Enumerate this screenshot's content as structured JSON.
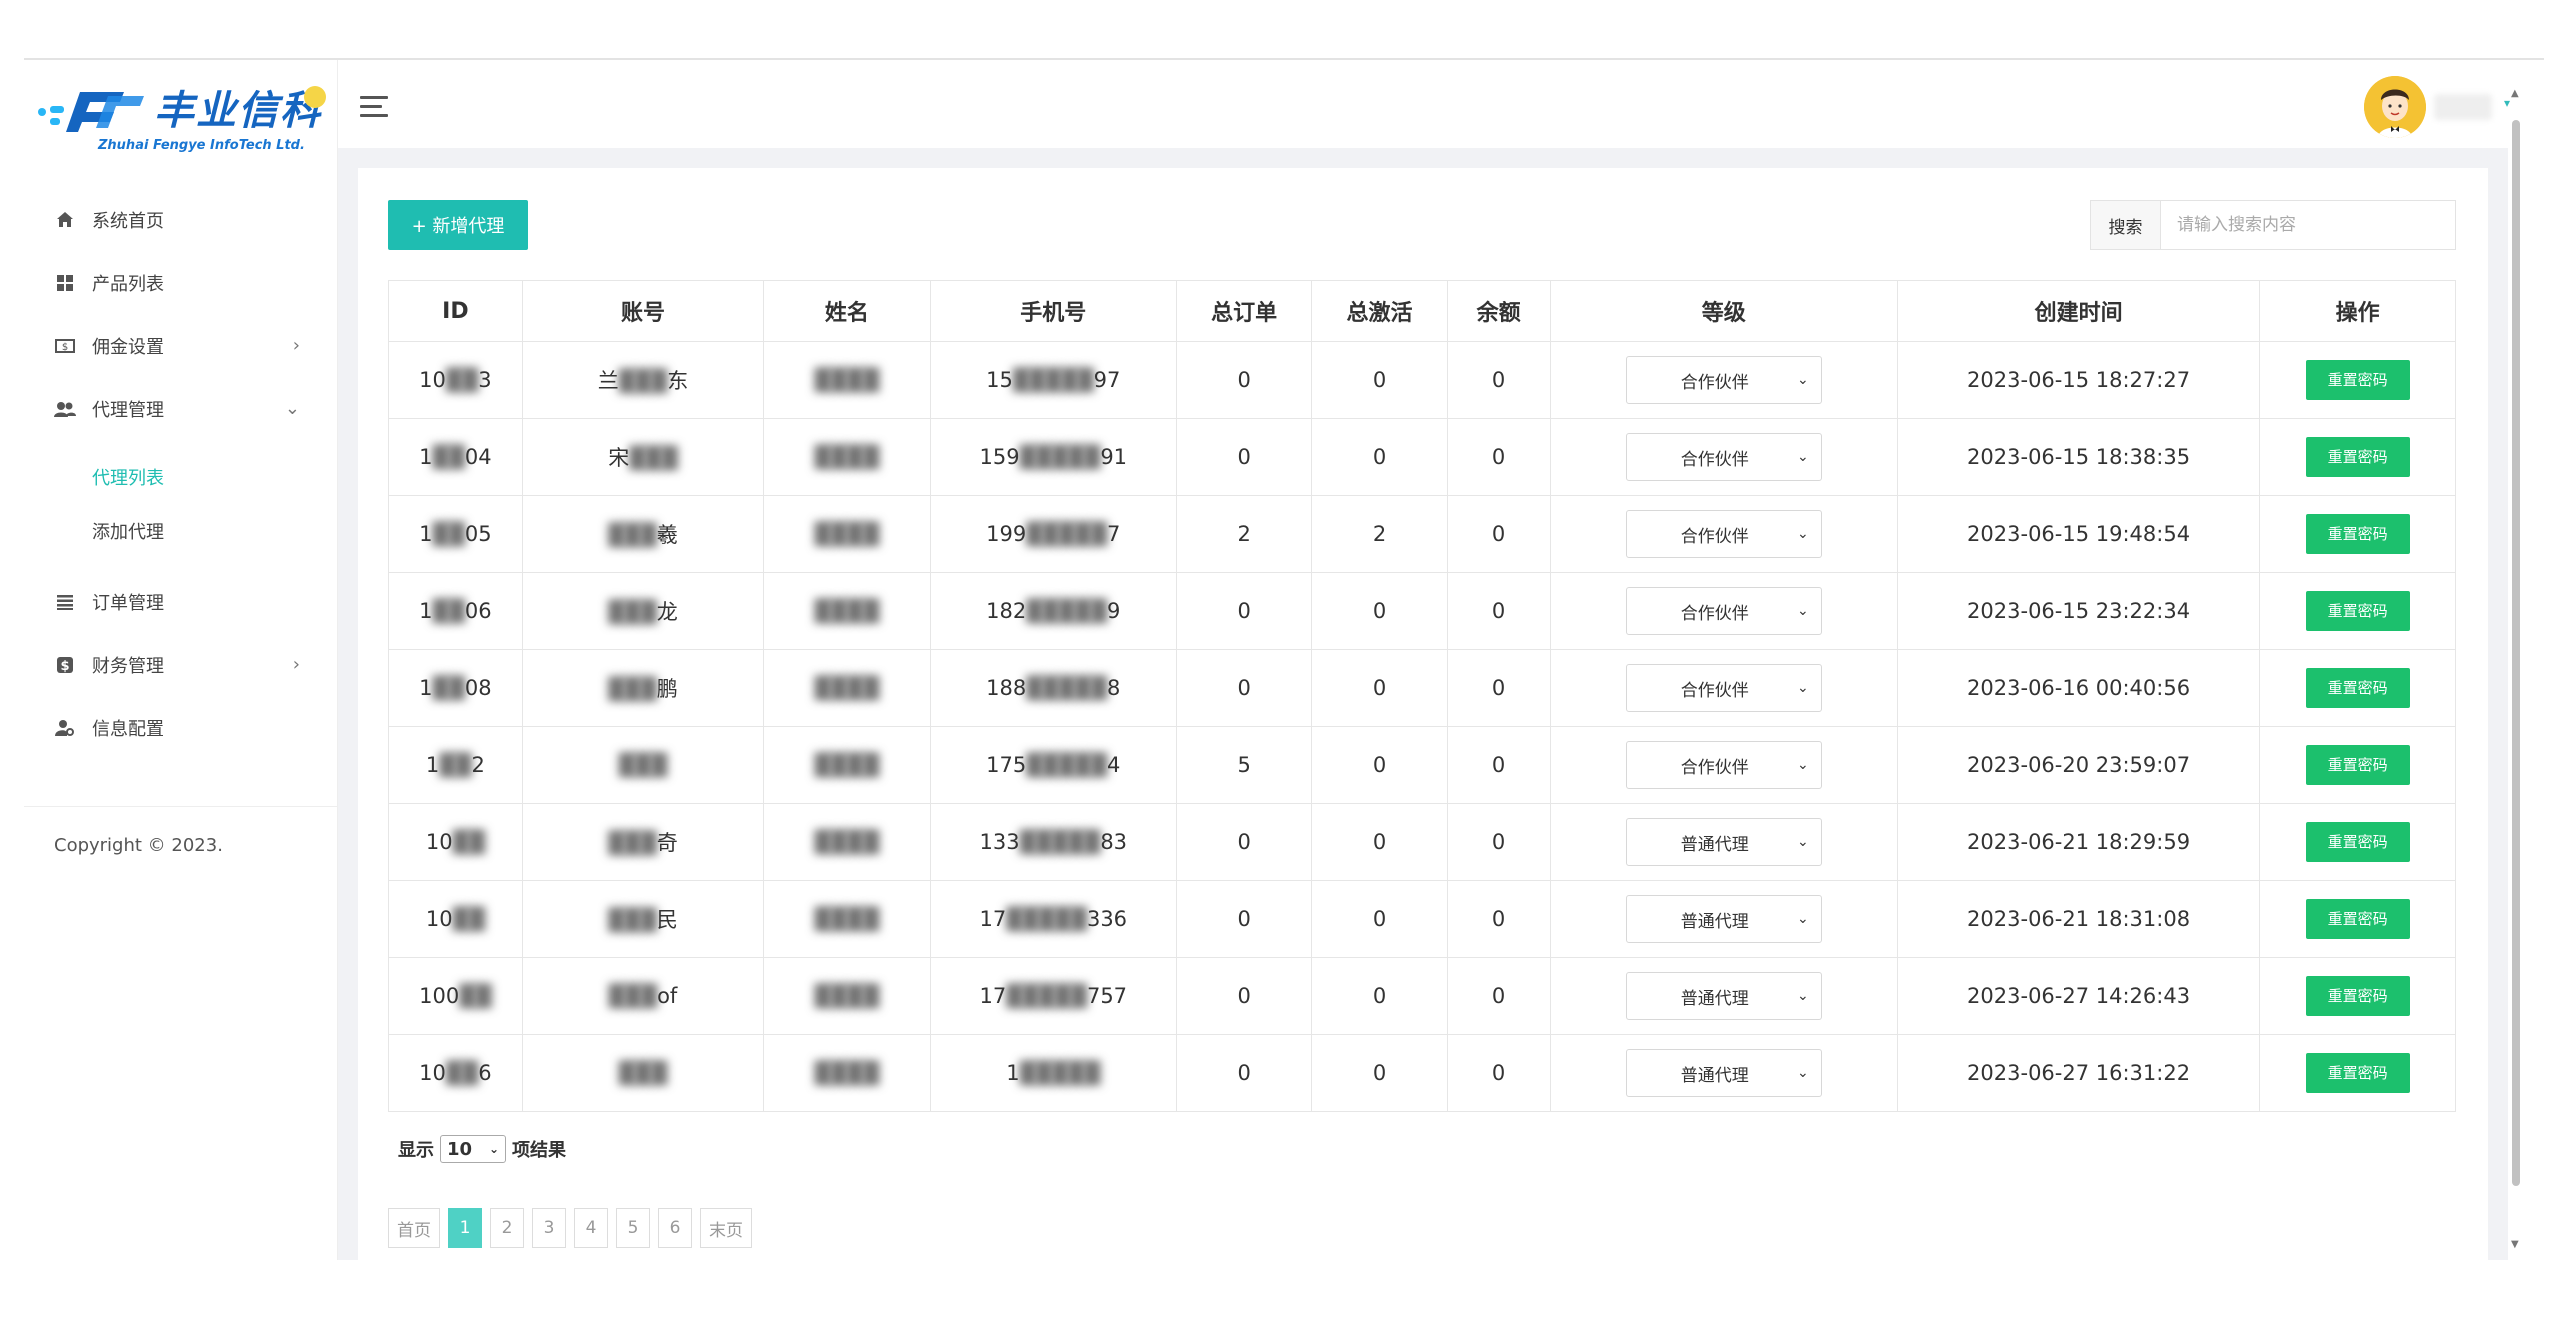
{
  "brand": {
    "name_cn": "丰业信科",
    "name_en": "Zhuhai Fengye InfoTech Ltd.",
    "color": "#1565c0"
  },
  "sidebar": {
    "items": [
      {
        "label": "系统首页",
        "icon": "home-icon"
      },
      {
        "label": "产品列表",
        "icon": "grid-icon"
      },
      {
        "label": "佣金设置",
        "icon": "money-icon",
        "caret": "›"
      },
      {
        "label": "代理管理",
        "icon": "users-icon",
        "caret": "⌄"
      },
      {
        "label": "订单管理",
        "icon": "list-icon"
      },
      {
        "label": "财务管理",
        "icon": "dollar-icon",
        "caret": "›"
      },
      {
        "label": "信息配置",
        "icon": "user-settings-icon"
      }
    ],
    "subitems": [
      {
        "label": "代理列表",
        "active": true
      },
      {
        "label": "添加代理",
        "active": false
      }
    ],
    "copyright": "Copyright © 2023."
  },
  "toolbar": {
    "add_label": "+ 新增代理",
    "search_label": "搜索",
    "search_placeholder": "请输入搜索内容"
  },
  "table": {
    "headers": [
      "ID",
      "账号",
      "姓名",
      "手机号",
      "总订单",
      "总激活",
      "余额",
      "等级",
      "创建时间",
      "操作"
    ],
    "action_label": "重置密码",
    "rows": [
      {
        "id_a": "10",
        "id_b": "3",
        "acc_a": "兰",
        "acc_b": "东",
        "phone_a": "15",
        "phone_b": "97",
        "orders": "0",
        "activations": "0",
        "balance": "0",
        "level": "合作伙伴",
        "created": "2023-06-15 18:27:27"
      },
      {
        "id_a": "1",
        "id_b": "04",
        "acc_a": "宋",
        "acc_b": "",
        "phone_a": "159",
        "phone_b": "91",
        "orders": "0",
        "activations": "0",
        "balance": "0",
        "level": "合作伙伴",
        "created": "2023-06-15 18:38:35"
      },
      {
        "id_a": "1",
        "id_b": "05",
        "acc_a": "",
        "acc_b": "羲",
        "phone_a": "199",
        "phone_b": "7",
        "orders": "2",
        "activations": "2",
        "balance": "0",
        "level": "合作伙伴",
        "created": "2023-06-15 19:48:54"
      },
      {
        "id_a": "1",
        "id_b": "06",
        "acc_a": "",
        "acc_b": "龙",
        "phone_a": "182",
        "phone_b": "9",
        "orders": "0",
        "activations": "0",
        "balance": "0",
        "level": "合作伙伴",
        "created": "2023-06-15 23:22:34"
      },
      {
        "id_a": "1",
        "id_b": "08",
        "acc_a": "",
        "acc_b": "鹏",
        "phone_a": "188",
        "phone_b": "8",
        "orders": "0",
        "activations": "0",
        "balance": "0",
        "level": "合作伙伴",
        "created": "2023-06-16 00:40:56"
      },
      {
        "id_a": "1",
        "id_b": "2",
        "acc_a": "",
        "acc_b": "",
        "phone_a": "175",
        "phone_b": "4",
        "orders": "5",
        "activations": "0",
        "balance": "0",
        "level": "合作伙伴",
        "created": "2023-06-20 23:59:07"
      },
      {
        "id_a": "10",
        "id_b": "",
        "acc_a": "",
        "acc_b": "奇",
        "phone_a": "133",
        "phone_b": "83",
        "orders": "0",
        "activations": "0",
        "balance": "0",
        "level": "普通代理",
        "created": "2023-06-21 18:29:59"
      },
      {
        "id_a": "10",
        "id_b": "",
        "acc_a": "",
        "acc_b": "民",
        "phone_a": "17",
        "phone_b": "336",
        "orders": "0",
        "activations": "0",
        "balance": "0",
        "level": "普通代理",
        "created": "2023-06-21 18:31:08"
      },
      {
        "id_a": "100",
        "id_b": "",
        "acc_a": "",
        "acc_b": "of",
        "phone_a": "17",
        "phone_b": "757",
        "orders": "0",
        "activations": "0",
        "balance": "0",
        "level": "普通代理",
        "created": "2023-06-27 14:26:43"
      },
      {
        "id_a": "10",
        "id_b": "6",
        "acc_a": "",
        "acc_b": "",
        "phone_a": "1",
        "phone_b": "",
        "orders": "0",
        "activations": "0",
        "balance": "0",
        "level": "普通代理",
        "created": "2023-06-27 16:31:22"
      }
    ]
  },
  "footer": {
    "len_prefix": "显示",
    "len_value": "10",
    "len_suffix": "项结果",
    "pages": [
      "首页",
      "1",
      "2",
      "3",
      "4",
      "5",
      "6",
      "末页"
    ],
    "current_page": "1"
  },
  "colors": {
    "accent": "#1fbdb1",
    "action": "#1cc06d"
  }
}
